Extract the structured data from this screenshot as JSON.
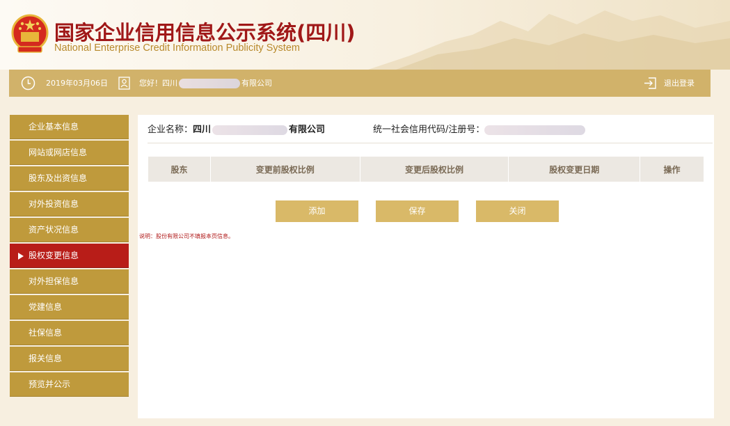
{
  "header": {
    "title_cn": "国家企业信用信息公示系统(四川)",
    "title_en": "National Enterprise Credit Information Publicity System"
  },
  "infobar": {
    "date": "2019年03月06日",
    "greeting_prefix": "您好！四川",
    "greeting_suffix": "有限公司",
    "logout_label": "退出登录",
    "icons": [
      "clock-icon",
      "user-icon",
      "logout-icon"
    ]
  },
  "sidebar": {
    "items": [
      {
        "label": "企业基本信息"
      },
      {
        "label": "网站或网店信息"
      },
      {
        "label": "股东及出资信息"
      },
      {
        "label": "对外投资信息"
      },
      {
        "label": "资产状况信息"
      },
      {
        "label": "股权变更信息",
        "active": true
      },
      {
        "label": "对外担保信息"
      },
      {
        "label": "党建信息"
      },
      {
        "label": "社保信息"
      },
      {
        "label": "报关信息"
      },
      {
        "label": "预览并公示"
      }
    ]
  },
  "main": {
    "company_label": "企业名称：",
    "company_prefix": "四川",
    "company_suffix": "有限公司",
    "code_label": "统一社会信用代码/注册号：",
    "table_headers": [
      "股东",
      "变更前股权比例",
      "变更后股权比例",
      "股权变更日期",
      "操作"
    ],
    "buttons": {
      "add": "添加",
      "save": "保存",
      "close": "关闭"
    },
    "note": "说明：股份有限公司不填报本页信息。"
  },
  "colors": {
    "gold": "#d1b26a",
    "sidebar": "#bf9a3c",
    "active": "#b81d18",
    "title_red": "#a01818"
  }
}
